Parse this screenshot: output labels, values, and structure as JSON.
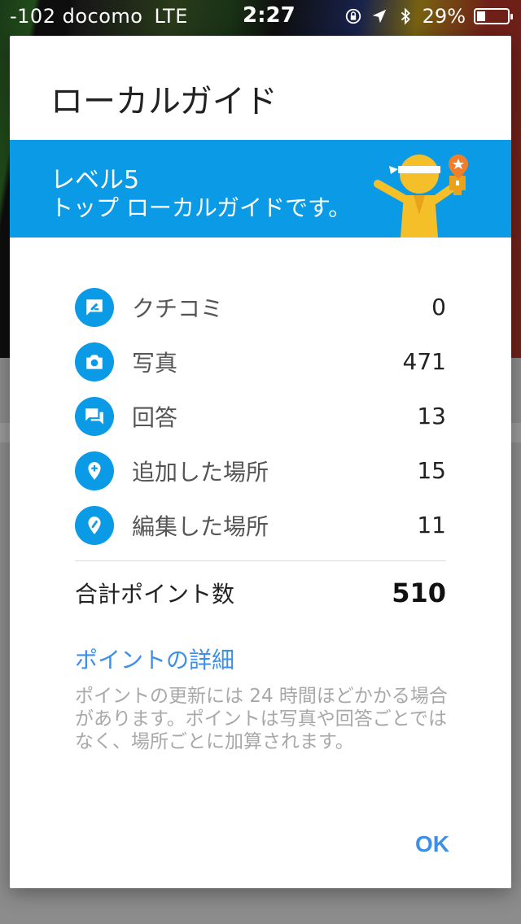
{
  "status_bar": {
    "carrier": "-102 docomo",
    "network": "LTE",
    "time": "2:27",
    "battery_percent": "29%",
    "battery_level": 0.29,
    "icons": [
      "lock-rotation-icon",
      "location-arrow-icon",
      "bluetooth-icon",
      "battery-icon"
    ]
  },
  "dialog": {
    "title": "ローカルガイド",
    "banner": {
      "level": "レベル5",
      "description": "トップ ローカルガイドです。",
      "color": "#0b9be6"
    },
    "stats": [
      {
        "icon": "review-icon",
        "label": "クチコミ",
        "value": "0"
      },
      {
        "icon": "camera-icon",
        "label": "写真",
        "value": "471"
      },
      {
        "icon": "answer-icon",
        "label": "回答",
        "value": "13"
      },
      {
        "icon": "add-place-icon",
        "label": "追加した場所",
        "value": "15"
      },
      {
        "icon": "edit-place-icon",
        "label": "編集した場所",
        "value": "11"
      }
    ],
    "total": {
      "label": "合計ポイント数",
      "value": "510"
    },
    "details_link": "ポイントの詳細",
    "note": "ポイントの更新には 24 時間ほどかかる場合があります。ポイントは写真や回答ごとではなく、場所ごとに加算されます。",
    "ok_label": "OK"
  }
}
